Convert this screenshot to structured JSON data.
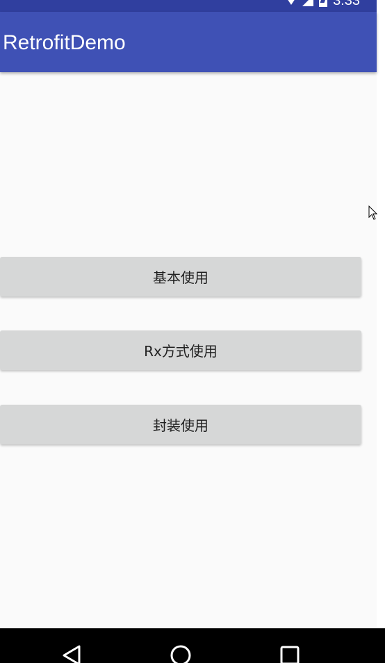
{
  "status_bar": {
    "time": "3:33",
    "icons": [
      "wifi-icon",
      "signal-icon",
      "battery-icon"
    ],
    "color": "#303F9F"
  },
  "app_bar": {
    "title": "RetrofitDemo",
    "color": "#3F51B5"
  },
  "buttons": [
    {
      "label": "基本使用"
    },
    {
      "label": "Rx方式使用"
    },
    {
      "label": "封装使用"
    }
  ],
  "nav_bar": {
    "icons": [
      "back-icon",
      "home-icon",
      "recents-icon"
    ]
  },
  "colors": {
    "background": "#FAFAFA",
    "button": "#D6D7D7",
    "button_text": "#212121"
  }
}
